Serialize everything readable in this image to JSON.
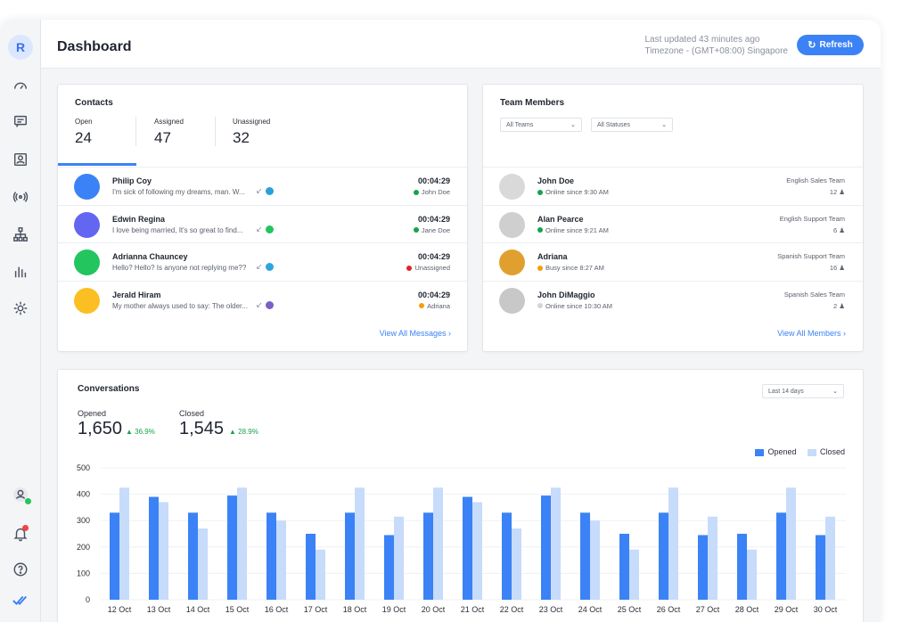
{
  "sidebar": {
    "avatar_letter": "R"
  },
  "header": {
    "title": "Dashboard",
    "last_updated": "Last updated 43 minutes ago",
    "timezone": "Timezone - (GMT+08:00) Singapore",
    "refresh_label": "Refresh"
  },
  "contacts": {
    "title": "Contacts",
    "tabs": [
      {
        "label": "Open",
        "count": "24"
      },
      {
        "label": "Assigned",
        "count": "47"
      },
      {
        "label": "Unassigned",
        "count": "32"
      }
    ],
    "rows": [
      {
        "name": "Philip Coy",
        "message": "I'm sick of following my dreams, man. W...",
        "time": "00:04:29",
        "agent": "John Doe",
        "agent_color": "#16a34a",
        "avatar_color": "#3b82f6",
        "channel_color": "#2b9fd9"
      },
      {
        "name": "Edwin Regina",
        "message": "I love being married, It's so great to find...",
        "time": "00:04:29",
        "agent": "Jane Doe",
        "agent_color": "#16a34a",
        "avatar_color": "#6366f1",
        "channel_color": "#22c55e"
      },
      {
        "name": "Adrianna Chauncey",
        "message": "Hello? Hello? Is anyone not replying me??",
        "time": "00:04:29",
        "agent": "Unassigned",
        "agent_color": "#dc2626",
        "avatar_color": "#22c55e",
        "channel_color": "#2ca5e0"
      },
      {
        "name": "Jerald Hiram",
        "message": "My mother always used to say: The older...",
        "time": "00:04:29",
        "agent": "Adriana",
        "agent_color": "#f59e0b",
        "avatar_color": "#fbbf24",
        "channel_color": "#7b5fc7"
      }
    ],
    "view_all": "View All Messages"
  },
  "team": {
    "title": "Team Members",
    "filters": {
      "teams": "All Teams",
      "statuses": "All Statuses"
    },
    "members": [
      {
        "name": "John Doe",
        "status": "Online since 9:30 AM",
        "status_color": "#16a34a",
        "team": "English Sales Team",
        "count": "12"
      },
      {
        "name": "Alan Pearce",
        "status": "Online since 9:21 AM",
        "status_color": "#16a34a",
        "team": "English Support Team",
        "count": "6"
      },
      {
        "name": "Adriana",
        "status": "Busy since 8:27 AM",
        "status_color": "#f59e0b",
        "team": "Spanish Support Team",
        "count": "16"
      },
      {
        "name": "John DiMaggio",
        "status": "Online since 10:30 AM",
        "status_color": "#d1d5db",
        "team": "Spanish Sales Team",
        "count": "2"
      }
    ],
    "view_all": "View All Members"
  },
  "conversations": {
    "title": "Conversations",
    "range": "Last 14 days",
    "opened_label": "Opened",
    "opened_value": "1,650",
    "opened_pct": "36.9%",
    "closed_label": "Closed",
    "closed_value": "1,545",
    "closed_pct": "28.9%"
  },
  "colors": {
    "accent": "#3b82f6",
    "opened": "#3b82f6",
    "closed": "#c7dbfb"
  },
  "chart_data": {
    "type": "bar",
    "categories": [
      "12 Oct",
      "13 Oct",
      "14 Oct",
      "15 Oct",
      "16 Oct",
      "17 Oct",
      "18 Oct",
      "19 Oct",
      "20 Oct",
      "21 Oct",
      "22 Oct",
      "23 Oct",
      "24 Oct",
      "25 Oct",
      "26 Oct",
      "27 Oct",
      "28 Oct",
      "29 Oct",
      "30 Oct"
    ],
    "series": [
      {
        "name": "Opened",
        "values": [
          330,
          390,
          330,
          395,
          330,
          250,
          330,
          245,
          330,
          390,
          330,
          395,
          330,
          250,
          330,
          245,
          250,
          330,
          245
        ]
      },
      {
        "name": "Closed",
        "values": [
          425,
          370,
          270,
          425,
          300,
          190,
          425,
          315,
          425,
          370,
          270,
          425,
          300,
          190,
          425,
          315,
          190,
          425,
          315
        ]
      }
    ],
    "yticks": [
      0,
      100,
      200,
      300,
      400,
      500
    ],
    "ylim": [
      0,
      500
    ],
    "legend": "top-right"
  }
}
